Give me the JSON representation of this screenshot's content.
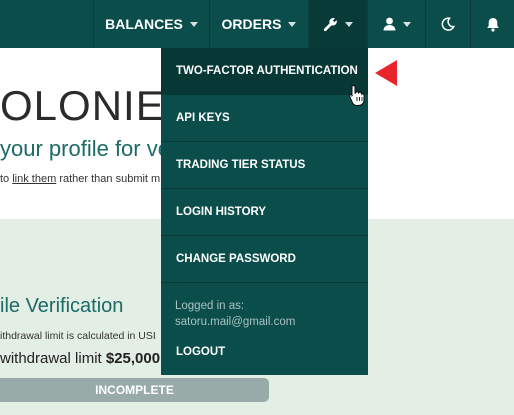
{
  "nav": {
    "balances_label": "BALANCES",
    "orders_label": "ORDERS",
    "icons": [
      "wrench-icon",
      "user-icon",
      "moon-icon",
      "bell-icon"
    ]
  },
  "page": {
    "logo_text": "OLONIEX",
    "verify_title": "your profile for verif",
    "verify_sub_before": "to ",
    "verify_sub_link": "link them",
    "verify_sub_after": " rather than submit m",
    "section_title": "ile Verification",
    "section_desc": "ithdrawal limit is calculated in USI",
    "limit_prefix": "withdrawal limit ",
    "limit_value": "$25,000",
    "status_button": "INCOMPLETE"
  },
  "dropdown": {
    "items": [
      {
        "label": "TWO-FACTOR AUTHENTICATION"
      },
      {
        "label": "API KEYS"
      },
      {
        "label": "TRADING TIER STATUS"
      },
      {
        "label": "LOGIN HISTORY"
      },
      {
        "label": "CHANGE PASSWORD"
      }
    ],
    "logged_in_label": "Logged in as:",
    "logged_in_email": "satoru.mail@gmail.com",
    "logout_label": "LOGOUT"
  },
  "colors": {
    "nav_bg": "#0b4d4b",
    "accent_teal": "#1b6b66",
    "section_bg": "#e3eee5",
    "annotation_arrow": "#e8252b"
  }
}
